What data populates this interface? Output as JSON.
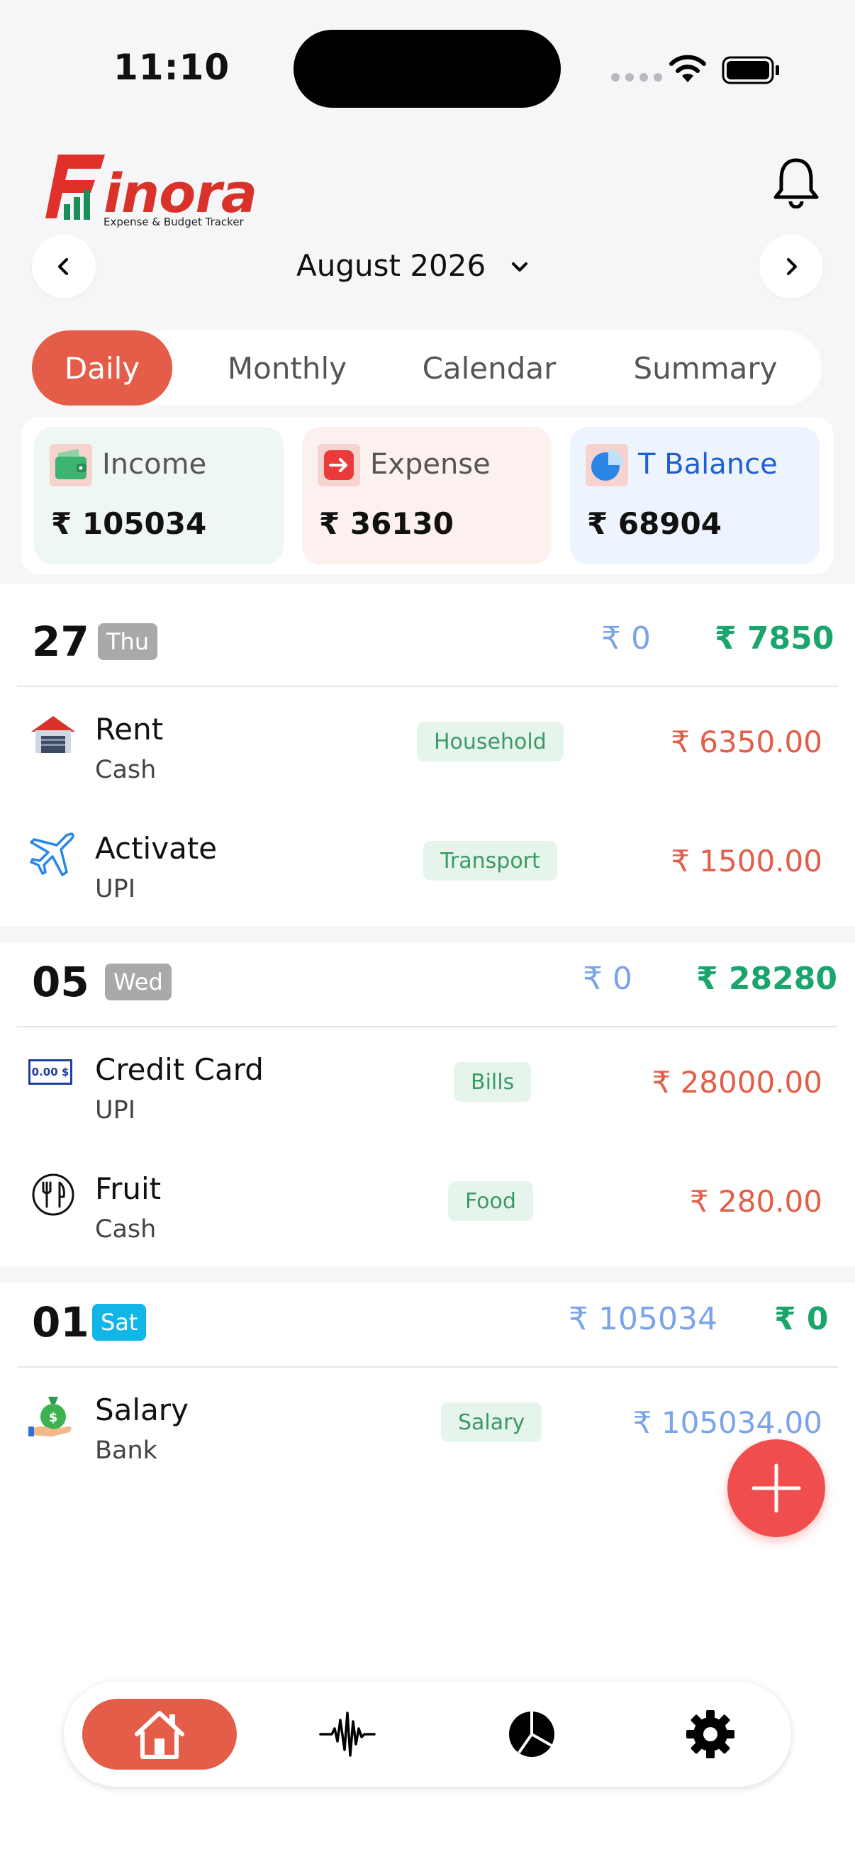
{
  "status_bar": {
    "time": "11:10"
  },
  "brand": {
    "name": "inora",
    "tagline": "Expense & Budget Tracker"
  },
  "period": {
    "label": "August 2026"
  },
  "tabs": [
    {
      "label": "Daily",
      "active": true
    },
    {
      "label": "Monthly",
      "active": false
    },
    {
      "label": "Calendar",
      "active": false
    },
    {
      "label": "Summary",
      "active": false
    }
  ],
  "summary": {
    "income": {
      "label": "Income",
      "value": "₹ 105034"
    },
    "expense": {
      "label": "Expense",
      "value": "₹ 36130"
    },
    "balance": {
      "label": "T Balance",
      "value": "₹ 68904"
    }
  },
  "days": [
    {
      "day": "27",
      "weekday": "Thu",
      "income": "₹ 0",
      "expense": "₹ 7850",
      "items": [
        {
          "title": "Rent",
          "method": "Cash",
          "category": "Household",
          "amount": "₹ 6350.00",
          "icon": "house-icon"
        },
        {
          "title": "Activate",
          "method": "UPI",
          "category": "Transport",
          "amount": "₹ 1500.00",
          "icon": "airplane-icon"
        }
      ]
    },
    {
      "day": "05",
      "weekday": "Wed",
      "income": "₹ 0",
      "expense": "₹ 28280",
      "items": [
        {
          "title": "Credit Card",
          "method": "UPI",
          "category": "Bills",
          "amount": "₹ 28000.00",
          "icon": "receipt-icon",
          "icon_text": "0.00 $"
        },
        {
          "title": "Fruit",
          "method": "Cash",
          "category": "Food",
          "amount": "₹ 280.00",
          "icon": "fork-knife-icon"
        }
      ]
    },
    {
      "day": "01",
      "weekday": "Sat",
      "income": "₹ 105034",
      "expense": "₹ 0",
      "items": [
        {
          "title": "Salary",
          "method": "Bank",
          "category": "Salary",
          "amount": "₹ 105034.00",
          "icon": "money-bag-icon"
        }
      ]
    }
  ],
  "colors": {
    "accent": "#e35d48",
    "income_blue": "#7aa4e9",
    "expense_green": "#1aa56c",
    "fab": "#f04e4e"
  },
  "nav": {
    "items": [
      {
        "icon": "home-icon",
        "active": true
      },
      {
        "icon": "activity-icon",
        "active": false
      },
      {
        "icon": "pie-chart-icon",
        "active": false
      },
      {
        "icon": "gear-icon",
        "active": false
      }
    ]
  }
}
